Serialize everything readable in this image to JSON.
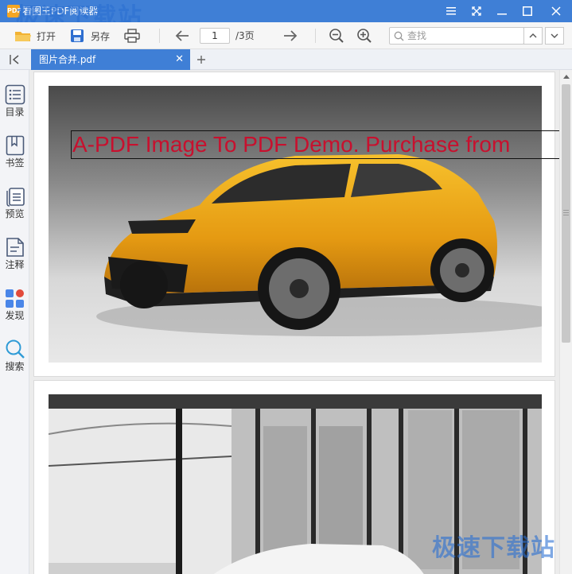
{
  "window": {
    "title": "看图王PDF阅读器",
    "app_icon_text": "PDF",
    "watermark": "极速下载站",
    "controls": [
      "menu-icon",
      "fullscreen-icon",
      "minimize-icon",
      "maximize-icon",
      "close-icon"
    ]
  },
  "toolbar": {
    "open_label": "打开",
    "save_label": "另存",
    "current_page": "1",
    "total_pages": "/3页",
    "search_placeholder": "查找"
  },
  "tabs": [
    {
      "label": "图片合并.pdf",
      "active": true
    }
  ],
  "sidebar": {
    "items": [
      {
        "label": "目录",
        "icon": "list-icon"
      },
      {
        "label": "书签",
        "icon": "bookmark-icon"
      },
      {
        "label": "预览",
        "icon": "thumbnails-icon"
      },
      {
        "label": "注释",
        "icon": "annotation-icon"
      },
      {
        "label": "发现",
        "icon": "discover-icon"
      },
      {
        "label": "搜索",
        "icon": "search-icon"
      }
    ]
  },
  "document": {
    "pages": [
      {
        "image": "yellow-suv-photo",
        "banner": "A-PDF Image To PDF Demo. Purchase from"
      },
      {
        "image": "showroom-photo"
      }
    ]
  },
  "colors": {
    "accent": "#3f7fd6",
    "banner_text": "#c8102e"
  }
}
